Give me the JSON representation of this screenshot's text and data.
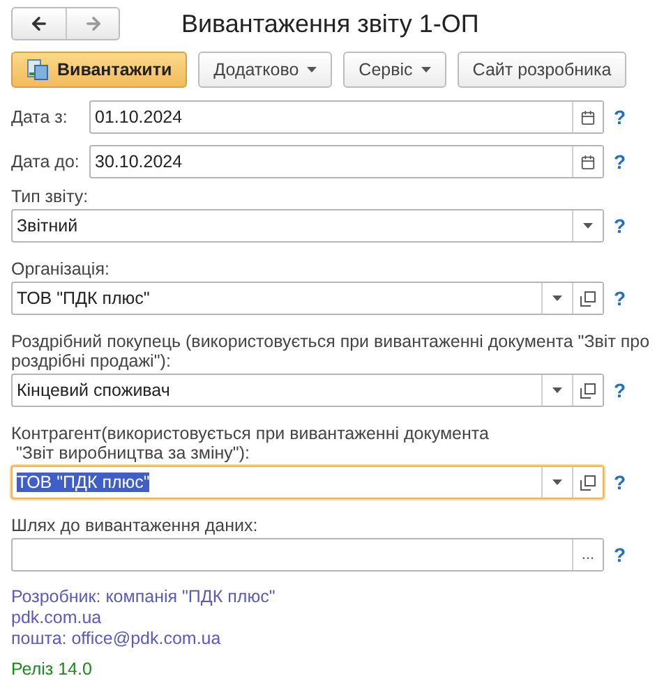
{
  "window": {
    "title": "Вивантаження звіту 1-ОП"
  },
  "toolbar": [
    {
      "label": "Вивантажити",
      "kind": "primary"
    },
    {
      "label": "Додатково",
      "kind": "menu"
    },
    {
      "label": "Сервіс",
      "kind": "menu"
    },
    {
      "label": "Сайт розробника",
      "kind": "plain"
    }
  ],
  "fields": [
    {
      "kind": "date",
      "label": "Дата з:",
      "value": "01.10.2024",
      "help": "?",
      "focused": false
    },
    {
      "kind": "date",
      "label": "Дата до:",
      "value": "30.10.2024",
      "help": "?",
      "focused": false
    },
    {
      "kind": "select",
      "label": "Тип звіту:",
      "value": "Звітний",
      "help": "?",
      "focused": false
    },
    {
      "kind": "ref",
      "label": "Організація:",
      "value": "ТОВ \"ПДК плюс\"",
      "help": "?",
      "focused": false
    },
    {
      "kind": "ref",
      "label": "Роздрібний покупець (використовується при вивантаженні документа \"Звіт про роздрібні продажі\"):",
      "value": "Кінцевий споживач",
      "help": "?",
      "focused": false
    },
    {
      "kind": "ref",
      "label": "Контрагент(використовується при вивантаженні документа\n \"Звіт виробництва за зміну\"):",
      "value": "ТОВ \"ПДК плюс\"",
      "help": "?",
      "focused": true
    },
    {
      "kind": "path",
      "label": "Шлях до вивантаження даних:",
      "button": "...",
      "help": "?",
      "focused": false
    }
  ],
  "footer": {
    "developer": "Розробник: компанія \"ПДК плюс\"",
    "site": "pdk.com.ua",
    "email": "пошта: office@pdk.com.ua",
    "release": "Реліз 14.0"
  }
}
